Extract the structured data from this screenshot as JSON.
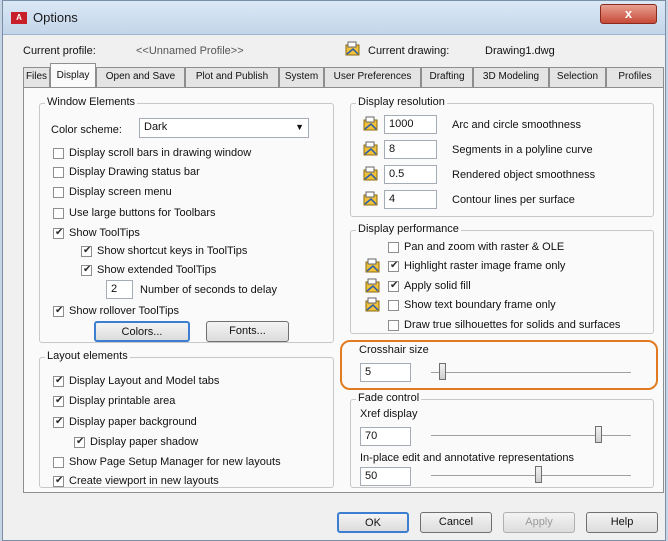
{
  "window": {
    "title": "Options",
    "close_glyph": "x"
  },
  "header": {
    "profile_label": "Current profile:",
    "profile_value": "<<Unnamed Profile>>",
    "drawing_label": "Current drawing:",
    "drawing_value": "Drawing1.dwg"
  },
  "tabs": [
    "Files",
    "Display",
    "Open and Save",
    "Plot and Publish",
    "System",
    "User Preferences",
    "Drafting",
    "3D Modeling",
    "Selection",
    "Profiles"
  ],
  "window_elements": {
    "title": "Window Elements",
    "color_scheme_label": "Color scheme:",
    "color_scheme_value": "Dark",
    "checks": [
      {
        "label": "Display scroll bars in drawing window",
        "checked": false
      },
      {
        "label": "Display Drawing status bar",
        "checked": false
      },
      {
        "label": "Display screen menu",
        "checked": false
      },
      {
        "label": "Use large buttons for Toolbars",
        "checked": false
      },
      {
        "label": "Show ToolTips",
        "checked": true
      },
      {
        "label": "Show shortcut keys in ToolTips",
        "checked": true
      },
      {
        "label": "Show extended ToolTips",
        "checked": true
      }
    ],
    "delay_value": "2",
    "delay_label": "Number of seconds to delay",
    "rollover": {
      "label": "Show rollover ToolTips",
      "checked": true
    },
    "colors_button": "Colors...",
    "fonts_button": "Fonts..."
  },
  "layout_elements": {
    "title": "Layout elements",
    "checks": [
      {
        "label": "Display Layout and Model tabs",
        "checked": true
      },
      {
        "label": "Display printable area",
        "checked": true
      },
      {
        "label": "Display paper background",
        "checked": true
      },
      {
        "label": "Display paper shadow",
        "checked": true
      },
      {
        "label": "Show Page Setup Manager for new layouts",
        "checked": false
      },
      {
        "label": "Create viewport in new layouts",
        "checked": true
      }
    ]
  },
  "display_resolution": {
    "title": "Display resolution",
    "rows": [
      {
        "value": "1000",
        "label": "Arc and circle smoothness"
      },
      {
        "value": "8",
        "label": "Segments in a polyline curve"
      },
      {
        "value": "0.5",
        "label": "Rendered object smoothness"
      },
      {
        "value": "4",
        "label": "Contour lines per surface"
      }
    ]
  },
  "display_performance": {
    "title": "Display performance",
    "checks": [
      {
        "label": "Pan and zoom with raster & OLE",
        "checked": false
      },
      {
        "label": "Highlight raster image frame only",
        "checked": true
      },
      {
        "label": "Apply solid fill",
        "checked": true
      },
      {
        "label": "Show text boundary frame only",
        "checked": false
      },
      {
        "label": "Draw true silhouettes for solids and surfaces",
        "checked": false
      }
    ]
  },
  "crosshair": {
    "title": "Crosshair size",
    "value": "5",
    "level_percent": 5
  },
  "fade_control": {
    "title": "Fade control",
    "xref_label": "Xref display",
    "xref_value": "70",
    "xref_level_percent": 70,
    "inplace_label": "In-place edit and annotative representations",
    "inplace_value": "50",
    "inplace_level_percent": 50
  },
  "footer": {
    "ok": "OK",
    "cancel": "Cancel",
    "apply": "Apply",
    "help": "Help"
  },
  "colors": {
    "highlight": "#e07b22",
    "close_button": "#c74a38"
  }
}
